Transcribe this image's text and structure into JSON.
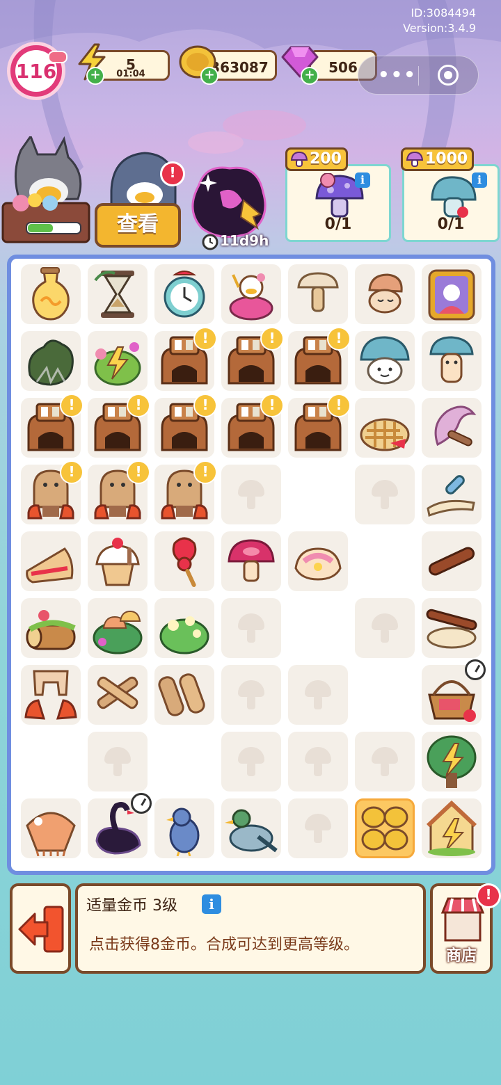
{
  "header": {
    "id_text": "ID:3084494",
    "version_text": "Version:3.4.9",
    "level": "116",
    "energy": {
      "value": "5",
      "timer": "01:04"
    },
    "coins": {
      "value": "363087"
    },
    "gems": {
      "value": "506"
    }
  },
  "characters": {
    "view_button": "查看",
    "event_timer": "11d9h"
  },
  "orders": [
    {
      "cost": "200",
      "progress": "0/1"
    },
    {
      "cost": "1000",
      "progress": "0/1"
    }
  ],
  "board": {
    "rows": [
      [
        "potion",
        "hourglass",
        "alarm-clock",
        "fairy-duck",
        "mushroom-sprite",
        "sleepy-mushroom",
        "portrait-frame"
      ],
      [
        "dead-bush",
        "energy-flowers",
        "oven-chest",
        "oven-chest",
        "oven-chest",
        "blue-mushroom",
        "mushroom-kid"
      ],
      [
        "oven-chest",
        "oven-chest",
        "oven-chest",
        "oven-chest",
        "oven-chest",
        "lattice-pie",
        "wind-spirit"
      ],
      [
        "puppet-hut",
        "puppet-hut",
        "puppet-hut",
        "empty",
        "clear",
        "empty",
        "rolling-pin-kit"
      ],
      [
        "pie-slice",
        "cupcake",
        "candy-stick",
        "jam-mushroom",
        "meringue",
        "clear",
        "rolling-pin"
      ],
      [
        "mossy-log",
        "mushroom-bush",
        "green-bush",
        "empty",
        "clear",
        "empty",
        "dough-roller"
      ],
      [
        "leggings",
        "wood-planks",
        "wood-logs",
        "empty",
        "empty",
        "clear",
        "picnic-basket"
      ],
      [
        "clear",
        "empty",
        "clear",
        "empty",
        "empty",
        "empty",
        "energy-tree"
      ],
      [
        "shawl",
        "black-swan",
        "pigeon",
        "duck",
        "empty",
        "coins",
        "energy-house"
      ]
    ],
    "exclaim_cells": [
      "1-2",
      "1-3",
      "1-4",
      "2-0",
      "2-1",
      "2-2",
      "2-3",
      "2-4",
      "3-0",
      "3-1",
      "3-2"
    ],
    "clock_cells": [
      "6-6",
      "8-1"
    ],
    "selected_cell": "8-5"
  },
  "info_panel": {
    "title": "适量金币 3级",
    "description": "点击获得8金币。合成可达到更高等级。"
  },
  "shop": {
    "label": "商店"
  },
  "colors": {
    "board_border": "#6f8ee0",
    "button_gold": "#f3b62f",
    "frame_brown": "#7a4a2a"
  }
}
